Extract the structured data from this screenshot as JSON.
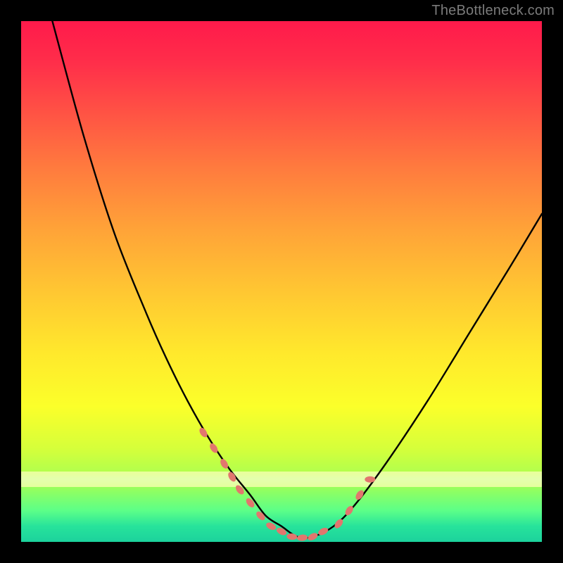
{
  "watermark": "TheBottleneck.com",
  "colors": {
    "background": "#000000",
    "curve_stroke": "#000000",
    "marker_fill": "#e2766e",
    "gradient_stops": [
      "#ff1a4b",
      "#ff2e4a",
      "#ff5444",
      "#ff7a3e",
      "#ffa338",
      "#ffc732",
      "#ffe92c",
      "#fbff2a",
      "#d6ff3a",
      "#a0ff56",
      "#5cff88",
      "#27e39b",
      "#1cd29c"
    ]
  },
  "chart_data": {
    "type": "line",
    "title": "",
    "xlabel": "",
    "ylabel": "",
    "xlim": [
      0,
      100
    ],
    "ylim": [
      0,
      100
    ],
    "pale_band_y": 88,
    "series": [
      {
        "name": "bottleneck-curve",
        "x": [
          6,
          12,
          18,
          24,
          28,
          32,
          36,
          40,
          44,
          47,
          50,
          53,
          56,
          60,
          64,
          70,
          78,
          86,
          94,
          100
        ],
        "y": [
          0,
          22,
          41,
          56,
          65,
          73,
          80,
          86,
          91,
          95,
          97,
          99,
          99,
          97,
          93,
          85,
          73,
          60,
          47,
          37
        ]
      }
    ],
    "markers": {
      "name": "highlighted-points",
      "x": [
        35,
        37,
        39,
        40.5,
        42,
        44,
        46,
        48,
        50,
        52,
        54,
        56,
        58,
        61,
        63,
        65,
        67
      ],
      "y": [
        79,
        82,
        85,
        87.5,
        90,
        92.5,
        95,
        97,
        98,
        99,
        99.2,
        99,
        98,
        96.5,
        94,
        91,
        88
      ]
    }
  }
}
